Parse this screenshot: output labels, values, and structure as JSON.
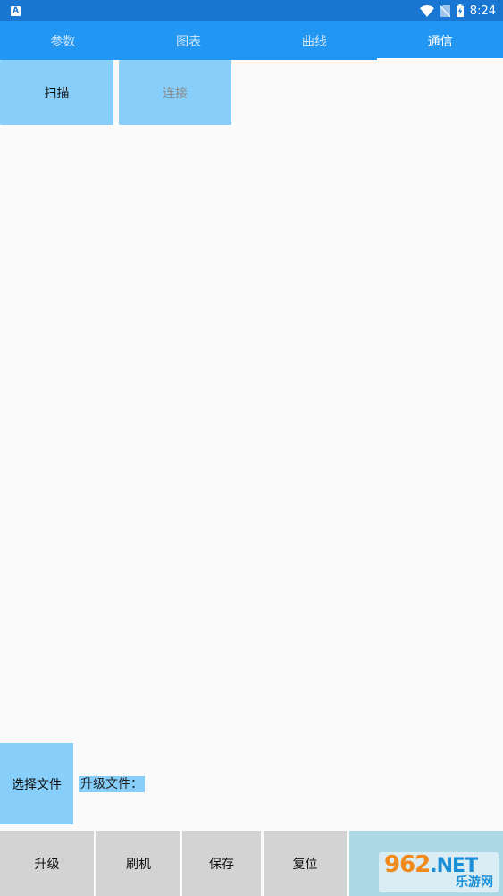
{
  "status_bar": {
    "notification_icon_letter": "A",
    "time": "8:24",
    "icons": [
      "wifi-icon",
      "no-sim-icon",
      "battery-charging-icon"
    ]
  },
  "tabs": [
    {
      "label": "参数",
      "active": false
    },
    {
      "label": "图表",
      "active": false
    },
    {
      "label": "曲线",
      "active": false
    },
    {
      "label": "通信",
      "active": true
    }
  ],
  "actions": {
    "scan_label": "扫描",
    "connect_label": "连接"
  },
  "file": {
    "select_label": "选择文件",
    "upgrade_file_label": "升级文件："
  },
  "bottom_bar": {
    "upgrade_label": "升级",
    "flash_label": "刷机",
    "save_label": "保存",
    "reset_label": "复位"
  },
  "watermark": {
    "digits": "962",
    "net": ".NET",
    "site": "乐游网"
  },
  "colors": {
    "status_bar": "#1976d2",
    "tab_bar": "#2196f3",
    "primary_button": "#87cefa",
    "bottom_button": "#d3d3d3",
    "bottom_extra": "#add8e6"
  }
}
